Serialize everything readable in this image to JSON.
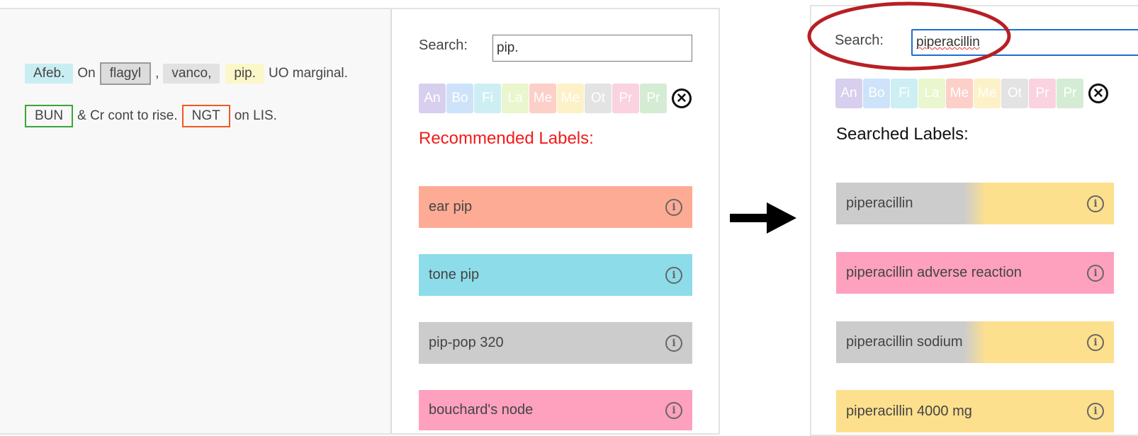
{
  "colors": {
    "label_colors": [
      "#d8cfef",
      "#cde3fa",
      "#cdeff4",
      "#eaf6cd",
      "#fccfc8",
      "#fdf1c8",
      "#e3e3e3",
      "#fbd2df",
      "#d5ecd4"
    ],
    "recommended_title": "#f21b1b",
    "annotation_circle": "#b81f23"
  },
  "note": {
    "line1": {
      "afeb": "Afeb.",
      "on": "On",
      "flagyl": "flagyl",
      "comma": ",",
      "vanco": "vanco,",
      "pip": "pip.",
      "rest": "UO marginal."
    },
    "line2": {
      "bun": "BUN",
      "cr": "& Cr cont to rise.",
      "ngt": "NGT",
      "lis": "on LIS."
    }
  },
  "left_panel": {
    "search_label": "Search:",
    "search_value": "pip.",
    "chips": [
      "An",
      "Bo",
      "Fi",
      "La",
      "Me",
      "Me",
      "Ot",
      "Pr",
      "Pr"
    ],
    "close_icon": "close-circle-icon",
    "section_title": "Recommended Labels:",
    "labels": [
      {
        "text": "ear pip",
        "color": "#fdab94"
      },
      {
        "text": "tone pip",
        "color": "#8ddce9"
      },
      {
        "text": "pip-pop 320",
        "color": "#cccccc"
      },
      {
        "text": "bouchard's node",
        "color": "#fda1bf"
      }
    ]
  },
  "arrow_icon": "right-arrow-icon",
  "right_panel": {
    "search_label": "Search:",
    "search_value": "piperacillin",
    "chips": [
      "An",
      "Bo",
      "Fi",
      "La",
      "Me",
      "Me",
      "Ot",
      "Pr",
      "Pr"
    ],
    "close_icon": "close-circle-icon",
    "section_title": "Searched Labels:",
    "labels": [
      {
        "text": "piperacillin",
        "colors": [
          "#cccccc",
          "#fde08d"
        ]
      },
      {
        "text": "piperacillin adverse reaction",
        "colors": [
          "#fda1bf"
        ]
      },
      {
        "text": "piperacillin sodium",
        "colors": [
          "#cccccc",
          "#fde08d"
        ]
      },
      {
        "text": "piperacillin 4000 mg",
        "colors": [
          "#fde08d"
        ]
      }
    ]
  }
}
